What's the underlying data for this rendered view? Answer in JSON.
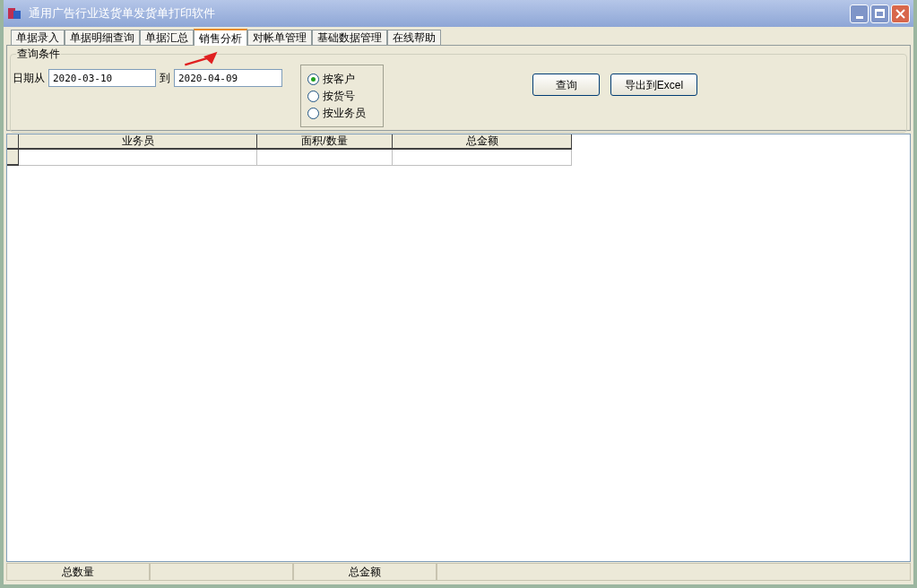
{
  "window": {
    "title": "通用广告行业送货单发货单打印软件"
  },
  "tabs": [
    {
      "label": "单据录入",
      "selected": false
    },
    {
      "label": "单据明细查询",
      "selected": false
    },
    {
      "label": "单据汇总",
      "selected": false
    },
    {
      "label": "销售分析",
      "selected": true
    },
    {
      "label": "对帐单管理",
      "selected": false
    },
    {
      "label": "基础数据管理",
      "selected": false
    },
    {
      "label": "在线帮助",
      "selected": false
    }
  ],
  "query": {
    "title": "查询条件",
    "date_from_label": "日期从",
    "date_from": "2020-03-10",
    "date_to_label": "到",
    "date_to": "2020-04-09",
    "options": [
      {
        "label": "按客户",
        "selected": true
      },
      {
        "label": "按货号",
        "selected": false
      },
      {
        "label": "按业务员",
        "selected": false
      }
    ],
    "buttons": [
      "查询",
      "导出到Excel"
    ]
  },
  "table": {
    "columns": [
      "业务员",
      "面积/数量",
      "总金额"
    ]
  },
  "status_bar": [
    {
      "kind": "text",
      "label": "总数量"
    },
    {
      "kind": "empty"
    },
    {
      "kind": "text",
      "label": "总金额"
    },
    {
      "kind": "empty"
    }
  ]
}
